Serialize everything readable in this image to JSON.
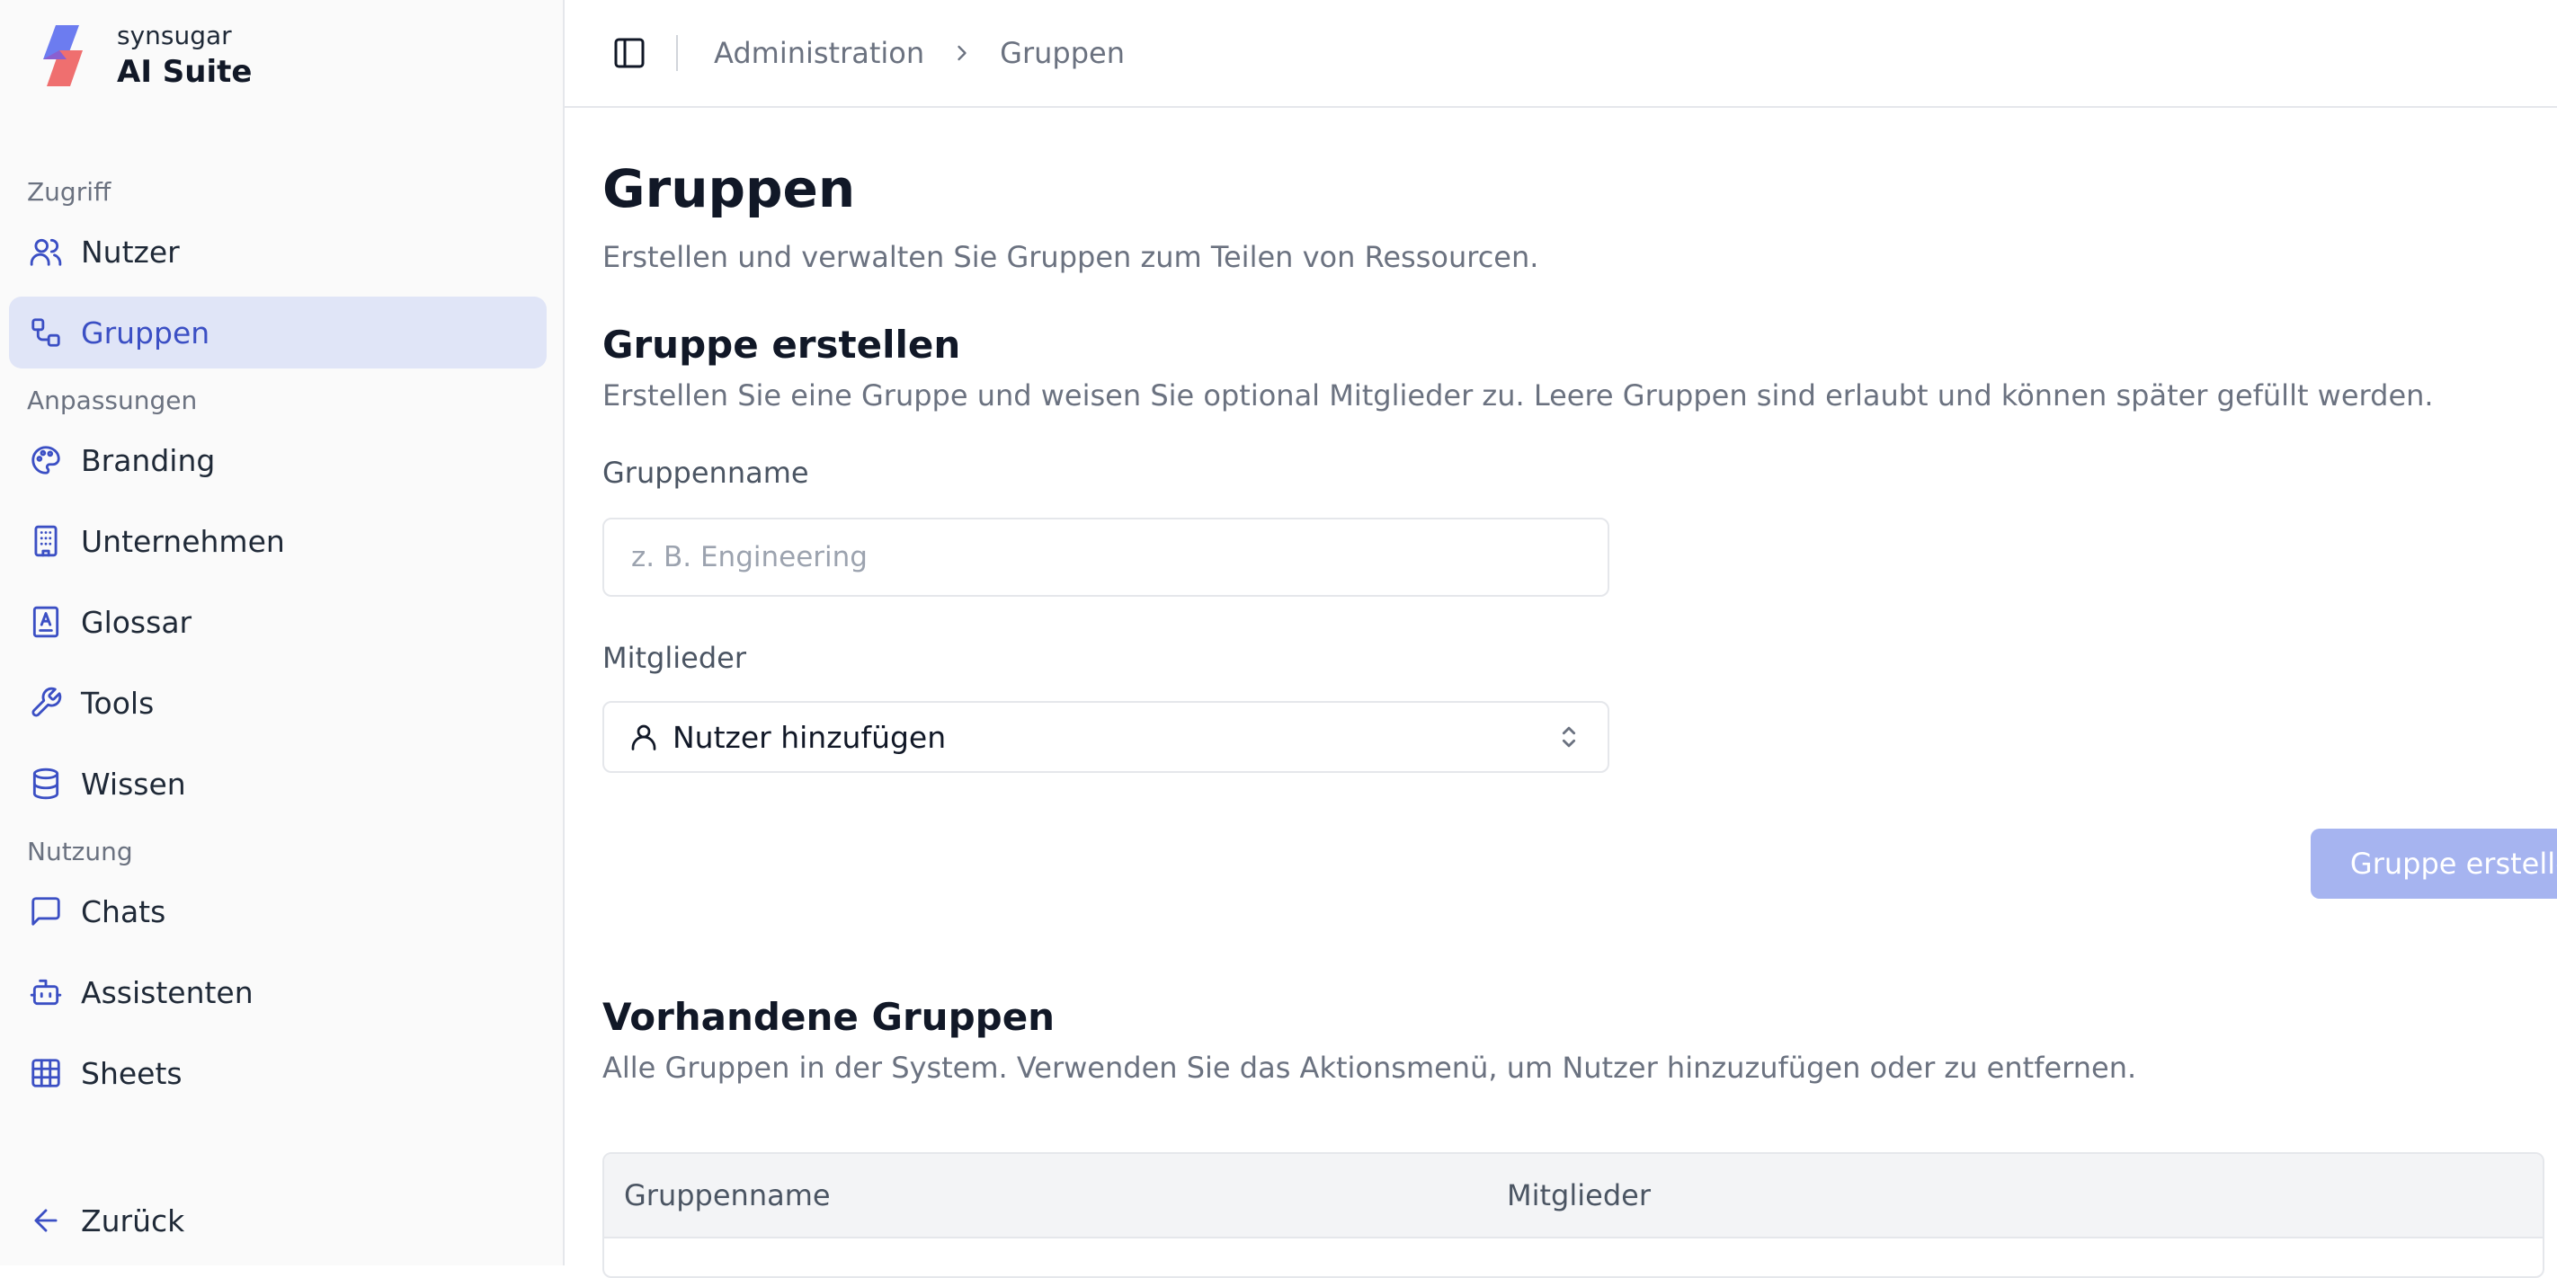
{
  "brand": {
    "company": "synsugar",
    "product": "AI Suite"
  },
  "sidebar": {
    "sections": [
      {
        "label": "Zugriff",
        "items": [
          {
            "label": "Nutzer",
            "icon": "users-icon"
          },
          {
            "label": "Gruppen",
            "icon": "groups-icon",
            "active": true
          }
        ]
      },
      {
        "label": "Anpassungen",
        "items": [
          {
            "label": "Branding",
            "icon": "palette-icon"
          },
          {
            "label": "Unternehmen",
            "icon": "building-icon"
          },
          {
            "label": "Glossar",
            "icon": "glossary-icon"
          },
          {
            "label": "Tools",
            "icon": "wrench-icon"
          },
          {
            "label": "Wissen",
            "icon": "database-icon"
          }
        ]
      },
      {
        "label": "Nutzung",
        "items": [
          {
            "label": "Chats",
            "icon": "chat-icon"
          },
          {
            "label": "Assistenten",
            "icon": "bot-icon"
          },
          {
            "label": "Sheets",
            "icon": "table-icon"
          }
        ]
      }
    ],
    "back_label": "Zurück"
  },
  "breadcrumb": {
    "parent": "Administration",
    "current": "Gruppen"
  },
  "page": {
    "title": "Gruppen",
    "subtitle": "Erstellen und verwalten Sie Gruppen zum Teilen von Ressourcen."
  },
  "create": {
    "title": "Gruppe erstellen",
    "description": "Erstellen Sie eine Gruppe und weisen Sie optional Mitglieder zu. Leere Gruppen sind erlaubt und können später gefüllt werden.",
    "name_label": "Gruppenname",
    "name_placeholder": "z. B. Engineering",
    "name_value": "",
    "members_label": "Mitglieder",
    "members_select": "Nutzer hinzufügen",
    "submit_label": "Gruppe erstellen"
  },
  "existing": {
    "title": "Vorhandene Gruppen",
    "description": "Alle Gruppen in der System. Verwenden Sie das Aktionsmenü, um Nutzer hinzuzufügen oder zu entfernen.",
    "columns": [
      "Gruppenname",
      "Mitglieder"
    ]
  },
  "colors": {
    "accent": "#3b4fc4",
    "active_bg": "#e0e5f7",
    "button_disabled": "#a6b4f0"
  }
}
